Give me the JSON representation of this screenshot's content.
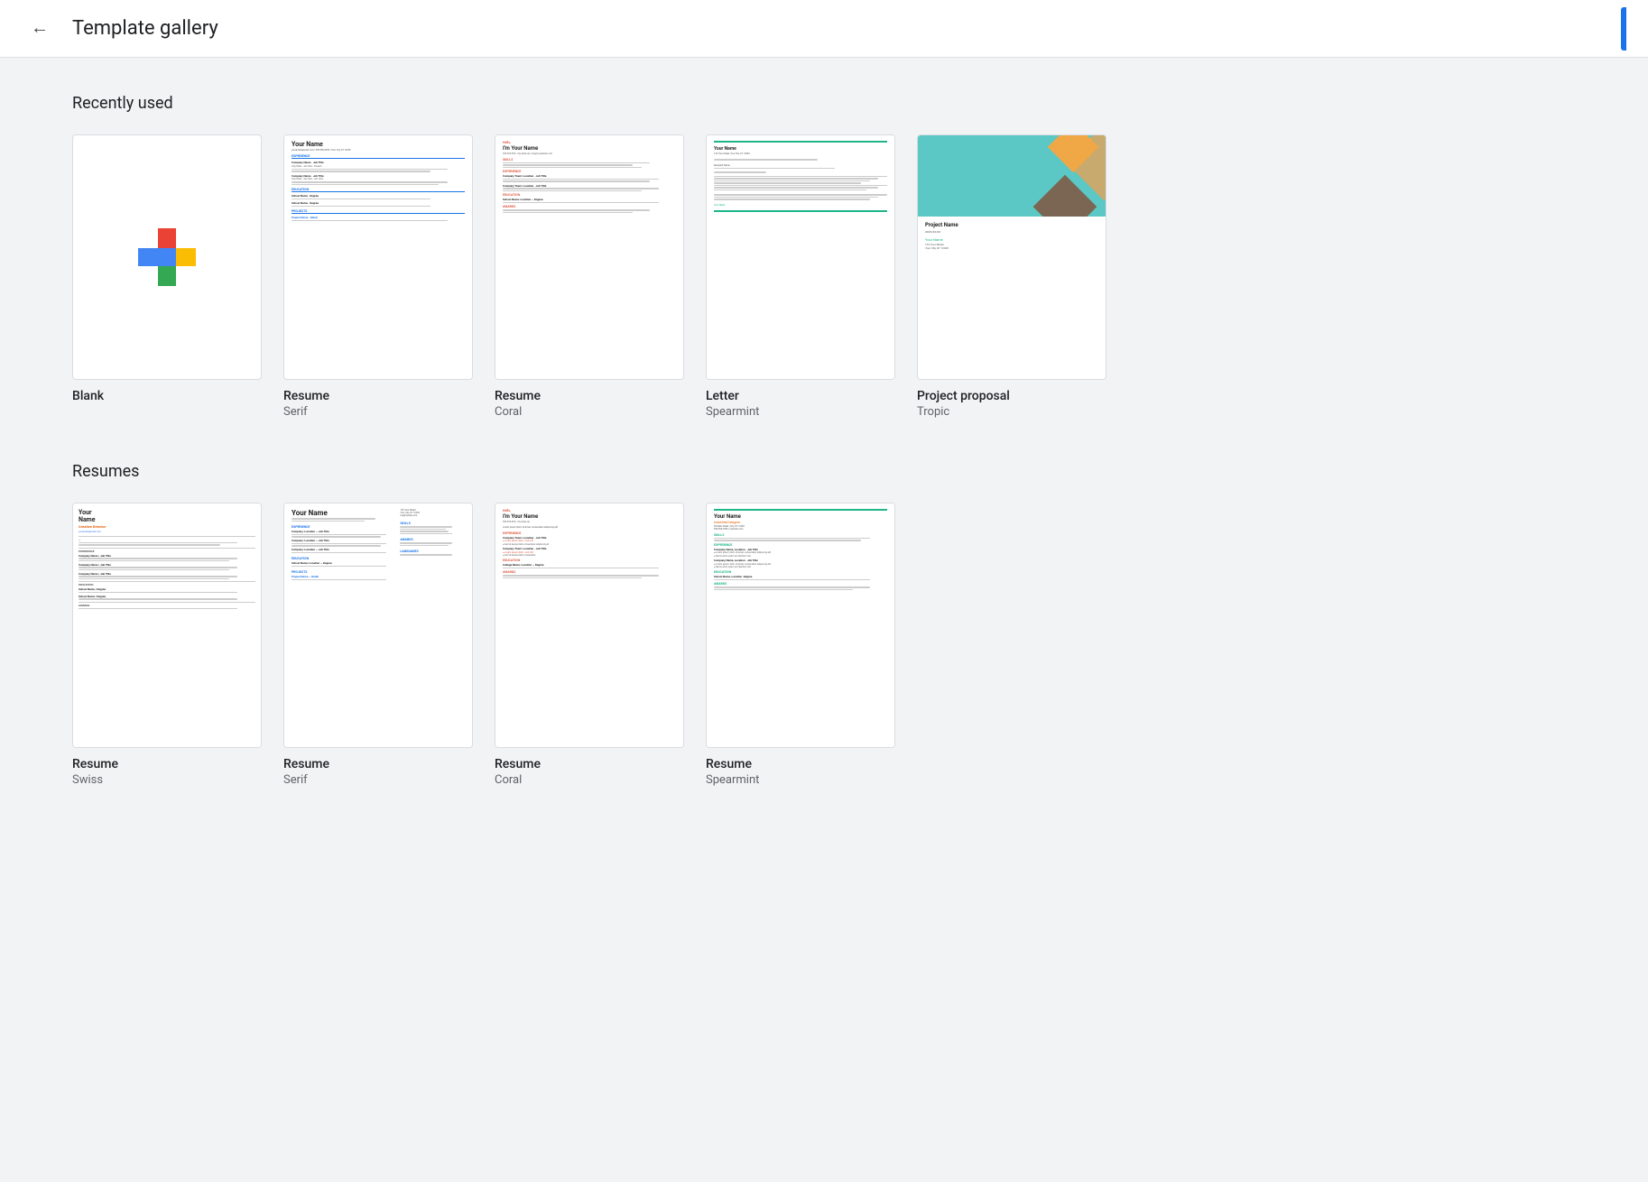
{
  "header": {
    "back_label": "←",
    "title": "Template gallery"
  },
  "recently_used": {
    "section_title": "Recently used",
    "templates": [
      {
        "id": "blank",
        "name": "Blank",
        "sub": ""
      },
      {
        "id": "resume-serif",
        "name": "Resume",
        "sub": "Serif"
      },
      {
        "id": "resume-coral",
        "name": "Resume",
        "sub": "Coral"
      },
      {
        "id": "letter-spearmint",
        "name": "Letter",
        "sub": "Spearmint"
      },
      {
        "id": "project-tropic",
        "name": "Project proposal",
        "sub": "Tropic"
      }
    ]
  },
  "resumes": {
    "section_title": "Resumes",
    "templates": [
      {
        "id": "resume-swiss",
        "name": "Resume",
        "sub": "Swiss"
      },
      {
        "id": "resume-serif2",
        "name": "Resume",
        "sub": "Serif"
      },
      {
        "id": "resume-coral2",
        "name": "Resume",
        "sub": "Coral"
      },
      {
        "id": "resume-spearmint",
        "name": "Resume",
        "sub": "Spearmint"
      }
    ]
  },
  "resume_serif": {
    "your_name": "Your Name"
  },
  "resume_coral_name": "It's Your Name",
  "project_name": "Project Name"
}
